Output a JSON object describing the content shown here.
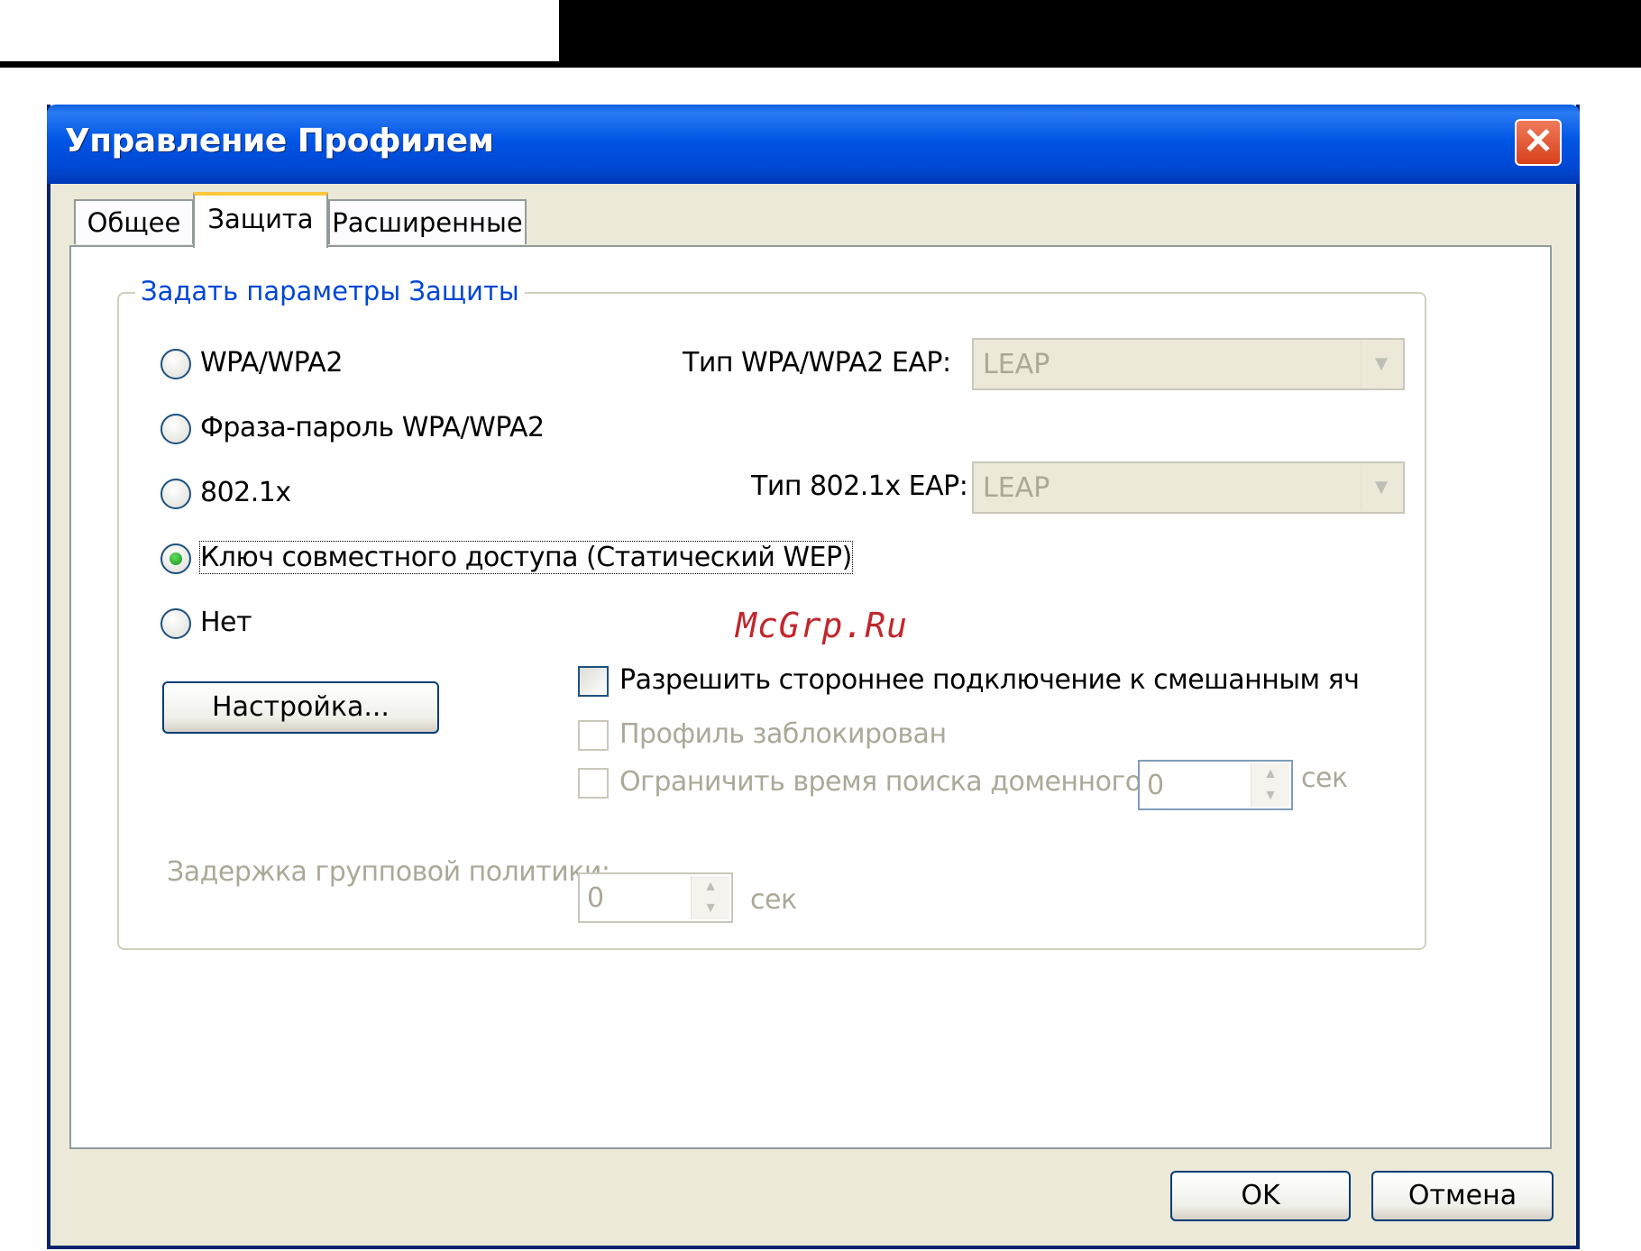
{
  "window": {
    "title": "Управление Профилем"
  },
  "tabs": [
    {
      "label": "Общее",
      "active": false
    },
    {
      "label": "Защита",
      "active": true
    },
    {
      "label": "Расширенные",
      "active": false
    }
  ],
  "security": {
    "group_title": "Задать параметры Защиты",
    "options": [
      {
        "label": "WPA/WPA2",
        "selected": false
      },
      {
        "label": "Фраза-пароль WPA/WPA2",
        "selected": false
      },
      {
        "label": "802.1x",
        "selected": false
      },
      {
        "label": "Ключ совместного доступа (Статический WEP)",
        "selected": true
      },
      {
        "label": "Нет",
        "selected": false
      }
    ],
    "wpa_eap_label": "Тип WPA/WPA2 EAP:",
    "wpa_eap_value": "LEAP",
    "dot1x_eap_label": "Тип 802.1x EAP:",
    "dot1x_eap_value": "LEAP",
    "settings_button": "Настройка...",
    "allow_mixed_label": "Разрешить стороннее подключение к смешанным яч",
    "allow_mixed_checked": false,
    "profile_locked_label": "Профиль заблокирован",
    "limit_search_label": "Ограничить время поиска доменного кс",
    "limit_search_value": "0",
    "limit_search_unit": "сек",
    "group_policy_label": "Задержка групповой политики:",
    "group_policy_value": "0",
    "group_policy_unit": "сек"
  },
  "watermark": "McGrp.Ru",
  "buttons": {
    "ok": "OK",
    "cancel": "Отмена"
  },
  "colors": {
    "title_bar": "#0055e5",
    "group_title": "#0046d5",
    "disabled_text": "#aca899",
    "watermark": "#c0272d"
  }
}
